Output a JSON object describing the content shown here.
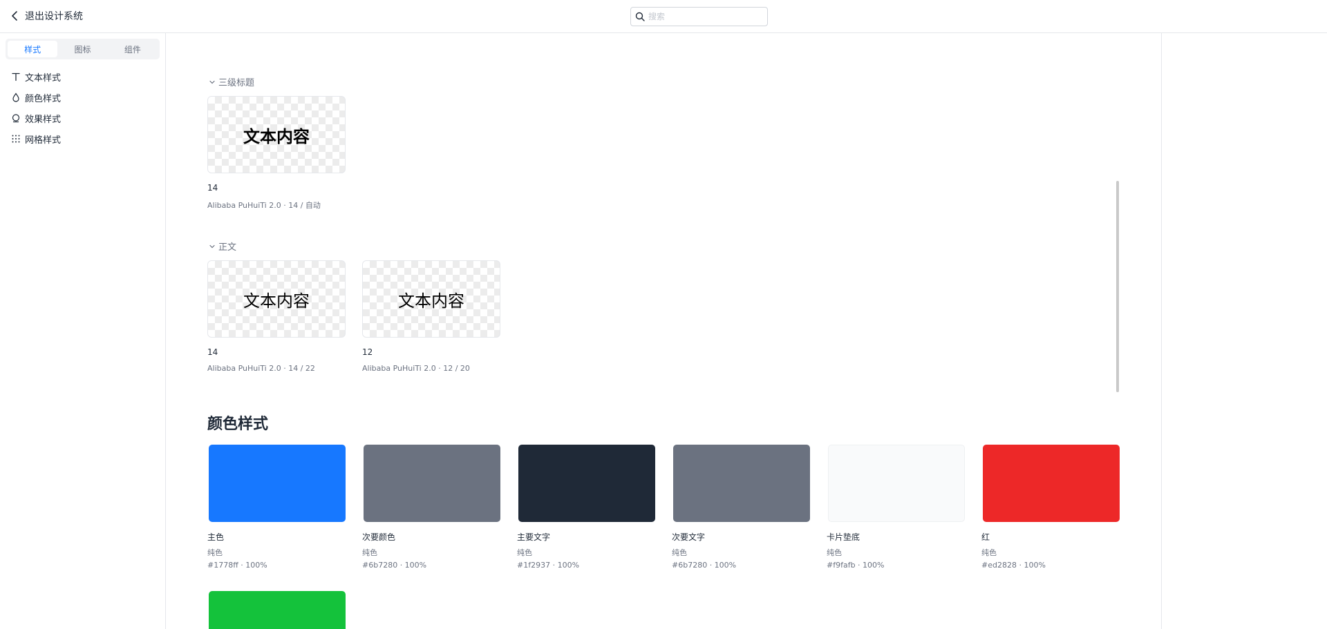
{
  "header": {
    "back_label": "退出设计系统",
    "search_placeholder": "搜索"
  },
  "sidebar": {
    "tabs": [
      {
        "label": "样式",
        "active": true
      },
      {
        "label": "图标",
        "active": false
      },
      {
        "label": "组件",
        "active": false
      }
    ],
    "items": [
      {
        "label": "文本样式",
        "icon": "text-icon"
      },
      {
        "label": "颜色样式",
        "icon": "droplet-icon"
      },
      {
        "label": "效果样式",
        "icon": "effect-icon"
      },
      {
        "label": "网格样式",
        "icon": "grid-icon"
      }
    ]
  },
  "text_styles": {
    "groups": [
      {
        "title": "三级标题",
        "items": [
          {
            "sample": "文本内容",
            "size": "14",
            "spec": "Alibaba PuHuiTi 2.0 · 14 / 自动",
            "bold": true
          }
        ]
      },
      {
        "title": "正文",
        "items": [
          {
            "sample": "文本内容",
            "size": "14",
            "spec": "Alibaba PuHuiTi 2.0 · 14 / 22",
            "bold": false
          },
          {
            "sample": "文本内容",
            "size": "12",
            "spec": "Alibaba PuHuiTi 2.0 · 12 / 20",
            "bold": false
          }
        ]
      }
    ]
  },
  "color_styles": {
    "title": "颜色样式",
    "swatches": [
      {
        "name": "主色",
        "type": "纯色",
        "value": "#1778ff · 100%",
        "color": "#1778ff"
      },
      {
        "name": "次要颜色",
        "type": "纯色",
        "value": "#6b7280 · 100%",
        "color": "#6b7280"
      },
      {
        "name": "主要文字",
        "type": "纯色",
        "value": "#1f2937 · 100%",
        "color": "#1f2937"
      },
      {
        "name": "次要文字",
        "type": "纯色",
        "value": "#6b7280 · 100%",
        "color": "#6b7280"
      },
      {
        "name": "卡片垫底",
        "type": "纯色",
        "value": "#f9fafb · 100%",
        "color": "#f9fafb"
      },
      {
        "name": "红",
        "type": "纯色",
        "value": "#ed2828 · 100%",
        "color": "#ed2828"
      }
    ],
    "partial_swatch_color": "#14c23b"
  }
}
